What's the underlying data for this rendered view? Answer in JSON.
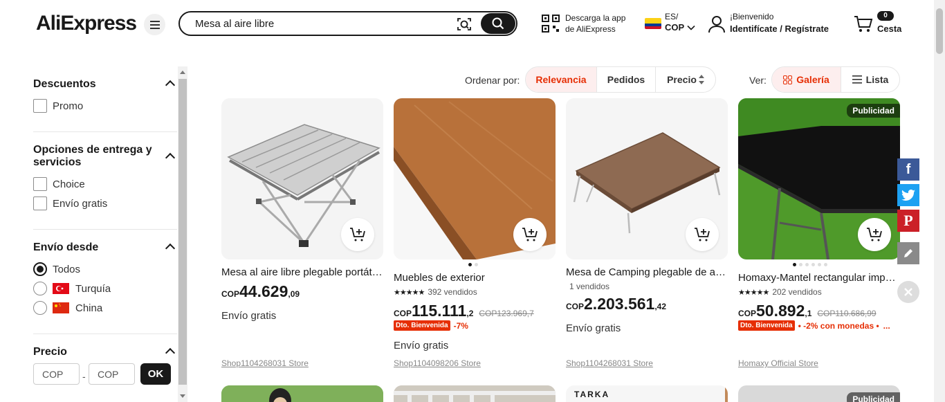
{
  "header": {
    "logo_main": "AliExpress",
    "search_value": "Mesa al aire libre",
    "app_line1": "Descarga la app",
    "app_line2": "de AliExpress",
    "lang_line1": "ES/",
    "lang_line2": "COP",
    "user_line1": "¡Bienvenido",
    "user_line2": "Identifícate / Regístrate",
    "cart_count": "0",
    "cart_label": "Cesta"
  },
  "sidebar": {
    "discounts_title": "Descuentos",
    "discounts_opt": "Promo",
    "delivery_title": "Opciones de entrega y servicios",
    "delivery_opts": [
      "Choice",
      "Envío gratis"
    ],
    "ship_from_title": "Envío desde",
    "ship_from_opts": [
      "Todos",
      "Turquía",
      "China"
    ],
    "price_title": "Precio",
    "price_min_placeholder": "COP",
    "price_max_placeholder": "COP",
    "price_dash": "-",
    "ok": "OK"
  },
  "sortbar": {
    "sort_label": "Ordenar por:",
    "sort_opts": [
      "Relevancia",
      "Pedidos",
      "Precio"
    ],
    "view_label": "Ver:",
    "view_opts": [
      "Galería",
      "Lista"
    ]
  },
  "products": [
    {
      "title": "Mesa al aire libre plegable portátil de aleación de aluminio",
      "currency": "COP",
      "price_int": "44.629",
      "price_dec": ",09",
      "shipping": "Envío gratis",
      "store": "Shop1104268031 Store"
    },
    {
      "title": "Muebles de exterior",
      "rating_text": "392 vendidos",
      "currency": "COP",
      "price_int": "115.111",
      "price_dec": ",2",
      "price_old": "COP123.969,7",
      "badge": "Dto. Bienvenida",
      "discount": "-7%",
      "shipping": "Envío gratis",
      "store": "Shop1104098206 Store"
    },
    {
      "title": "Mesa de Camping plegable de aleación de aluminio",
      "rating_text": "1 vendidos",
      "currency": "COP",
      "price_int": "2.203.561",
      "price_dec": ",42",
      "shipping": "Envío gratis",
      "store": "Shop1104268031 Store"
    },
    {
      "title": "Homaxy-Mantel rectangular impermeable",
      "ad": "Publicidad",
      "rating_text": "202 vendidos",
      "currency": "COP",
      "price_int": "50.892",
      "price_dec": ",1",
      "price_old": "COP110.686,99",
      "badge": "Dto. Bienvenida",
      "discount": "• -2% con monedas •",
      "more": "...",
      "store": "Homaxy Official Store"
    }
  ],
  "row2": {
    "card3_text": "TARKA",
    "card4_ad": "Publicidad"
  },
  "colors": {
    "accent": "#e62e04",
    "facebook": "#3b5998",
    "twitter": "#1da1f2",
    "pinterest": "#cb2027",
    "edit": "#8a8a8a"
  }
}
